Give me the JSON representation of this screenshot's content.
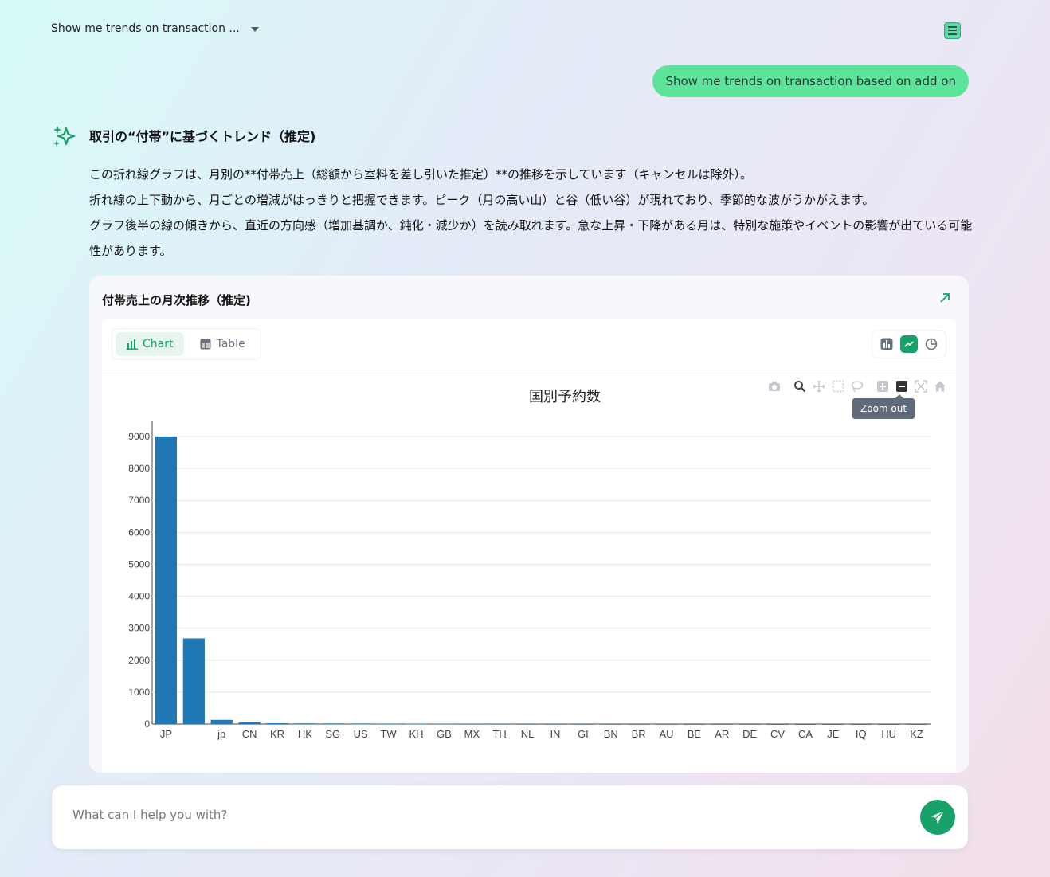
{
  "header": {
    "conversation_title": "Show me trends on transaction ..."
  },
  "user_message": "Show me trends on transaction based on add on",
  "assistant": {
    "title": "取引の“付帯”に基づくトレンド（推定)",
    "paragraphs": [
      "この折れ線グラフは、月別の**付帯売上（総額から室料を差し引いた推定）**の推移を示しています（キャンセルは除外）。",
      "折れ線の上下動から、月ごとの増減がはっきりと把握できます。ピーク（月の高い山）と谷（低い谷）が現れており、季節的な波がうかがえます。",
      "グラフ後半の線の傾きから、直近の方向感（増加基調か、鈍化・減少か）を読み取れます。急な上昇・下降がある月は、特別な施策やイベントの影響が出ている可能性があります。"
    ]
  },
  "card": {
    "title": "付帯売上の月次推移（推定)",
    "tabs": {
      "chart": "Chart",
      "table": "Table"
    },
    "tooltip": "Zoom out"
  },
  "chart_data": {
    "type": "bar",
    "title": "国別予約数",
    "categories": [
      "JP",
      "",
      "jp",
      "CN",
      "KR",
      "HK",
      "SG",
      "US",
      "TW",
      "KH",
      "GB",
      "MX",
      "TH",
      "NL",
      "IN",
      "GI",
      "BN",
      "BR",
      "AU",
      "BE",
      "AR",
      "DE",
      "CV",
      "CA",
      "JE",
      "IQ",
      "HU",
      "KZ"
    ],
    "values": [
      9000,
      2680,
      130,
      55,
      25,
      20,
      18,
      16,
      14,
      12,
      10,
      9,
      8,
      7,
      6,
      5,
      5,
      4,
      4,
      3,
      3,
      3,
      2,
      2,
      2,
      2,
      2,
      2
    ],
    "ylim": [
      0,
      9000
    ],
    "yticks": [
      0,
      1000,
      2000,
      3000,
      4000,
      5000,
      6000,
      7000,
      8000,
      9000
    ],
    "color": "#1f77b4",
    "grid": true
  },
  "input": {
    "placeholder": "What can I help you with?"
  },
  "colors": {
    "accent": "#18a26a",
    "user_bubble": "#5ee39a"
  }
}
